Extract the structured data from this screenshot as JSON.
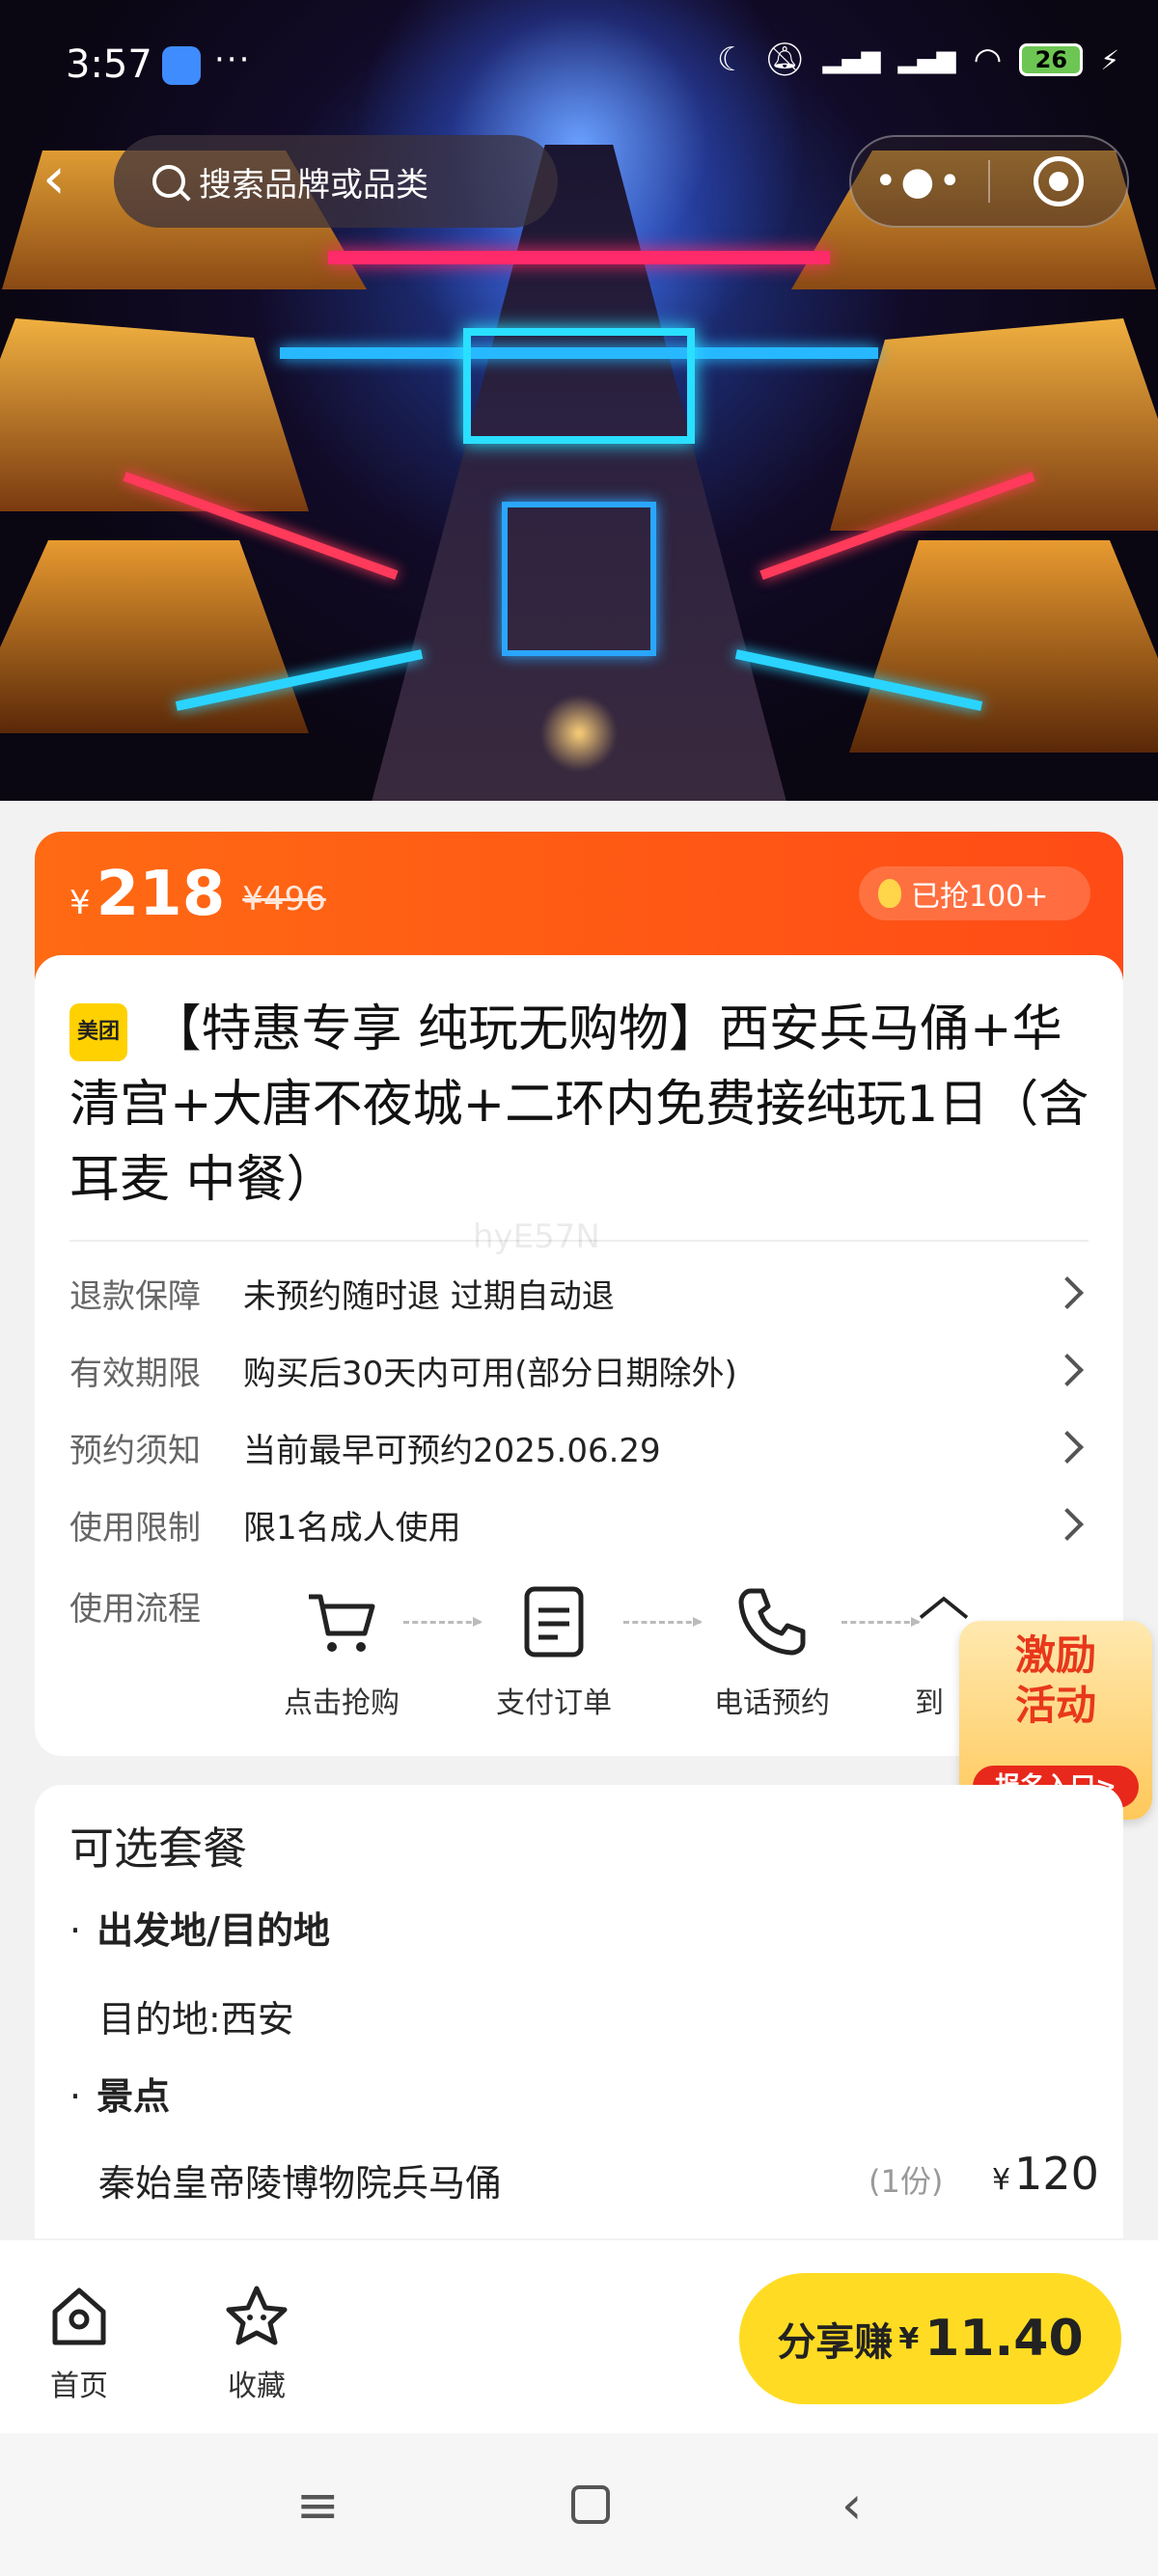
{
  "status_bar": {
    "time": "3:57",
    "battery": "26"
  },
  "search": {
    "placeholder": "搜索品牌或品类"
  },
  "price": {
    "currency": "¥",
    "current": "218",
    "original": "¥496",
    "sold": "已抢100+"
  },
  "product": {
    "brand_badge": "美团",
    "title": "【特惠专享 纯玩无购物】西安兵马俑+华清宫+大唐不夜城+二环内免费接纯玩1日（含耳麦 中餐）",
    "watermark": "hyE57N"
  },
  "info_rows": [
    {
      "key": "退款保障",
      "value": "未预约随时退 过期自动退"
    },
    {
      "key": "有效期限",
      "value": "购买后30天内可用(部分日期除外)"
    },
    {
      "key": "预约须知",
      "value": "当前最早可预约2025.06.29"
    },
    {
      "key": "使用限制",
      "value": "限1名成人使用"
    }
  ],
  "flow": {
    "label": "使用流程",
    "steps": [
      {
        "label": "点击抢购",
        "icon": "cart-icon"
      },
      {
        "label": "支付订单",
        "icon": "order-icon"
      },
      {
        "label": "电话预约",
        "icon": "phone-icon"
      },
      {
        "label": "到",
        "icon": "home-icon"
      }
    ]
  },
  "promo": {
    "line1": "激励",
    "line2": "活动",
    "button": "报名入口>"
  },
  "packages": {
    "title": "可选套餐",
    "section1": "出发地/目的地",
    "section1_value": "目的地:西安",
    "section2": "景点",
    "item_name": "秦始皇帝陵博物院兵马俑",
    "item_qty": "(1份)",
    "item_currency": "¥",
    "item_price": "120"
  },
  "bottom_nav": {
    "home": "首页",
    "favorite": "收藏",
    "share_label": "分享赚",
    "share_currency": "¥",
    "share_amount": "11.40"
  }
}
